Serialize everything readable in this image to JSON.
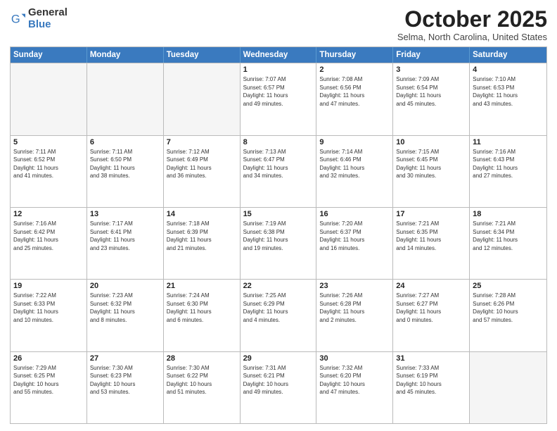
{
  "header": {
    "logo_general": "General",
    "logo_blue": "Blue",
    "month_title": "October 2025",
    "location": "Selma, North Carolina, United States"
  },
  "weekdays": [
    "Sunday",
    "Monday",
    "Tuesday",
    "Wednesday",
    "Thursday",
    "Friday",
    "Saturday"
  ],
  "rows": [
    [
      {
        "day": "",
        "info": ""
      },
      {
        "day": "",
        "info": ""
      },
      {
        "day": "",
        "info": ""
      },
      {
        "day": "1",
        "info": "Sunrise: 7:07 AM\nSunset: 6:57 PM\nDaylight: 11 hours\nand 49 minutes."
      },
      {
        "day": "2",
        "info": "Sunrise: 7:08 AM\nSunset: 6:56 PM\nDaylight: 11 hours\nand 47 minutes."
      },
      {
        "day": "3",
        "info": "Sunrise: 7:09 AM\nSunset: 6:54 PM\nDaylight: 11 hours\nand 45 minutes."
      },
      {
        "day": "4",
        "info": "Sunrise: 7:10 AM\nSunset: 6:53 PM\nDaylight: 11 hours\nand 43 minutes."
      }
    ],
    [
      {
        "day": "5",
        "info": "Sunrise: 7:11 AM\nSunset: 6:52 PM\nDaylight: 11 hours\nand 41 minutes."
      },
      {
        "day": "6",
        "info": "Sunrise: 7:11 AM\nSunset: 6:50 PM\nDaylight: 11 hours\nand 38 minutes."
      },
      {
        "day": "7",
        "info": "Sunrise: 7:12 AM\nSunset: 6:49 PM\nDaylight: 11 hours\nand 36 minutes."
      },
      {
        "day": "8",
        "info": "Sunrise: 7:13 AM\nSunset: 6:47 PM\nDaylight: 11 hours\nand 34 minutes."
      },
      {
        "day": "9",
        "info": "Sunrise: 7:14 AM\nSunset: 6:46 PM\nDaylight: 11 hours\nand 32 minutes."
      },
      {
        "day": "10",
        "info": "Sunrise: 7:15 AM\nSunset: 6:45 PM\nDaylight: 11 hours\nand 30 minutes."
      },
      {
        "day": "11",
        "info": "Sunrise: 7:16 AM\nSunset: 6:43 PM\nDaylight: 11 hours\nand 27 minutes."
      }
    ],
    [
      {
        "day": "12",
        "info": "Sunrise: 7:16 AM\nSunset: 6:42 PM\nDaylight: 11 hours\nand 25 minutes."
      },
      {
        "day": "13",
        "info": "Sunrise: 7:17 AM\nSunset: 6:41 PM\nDaylight: 11 hours\nand 23 minutes."
      },
      {
        "day": "14",
        "info": "Sunrise: 7:18 AM\nSunset: 6:39 PM\nDaylight: 11 hours\nand 21 minutes."
      },
      {
        "day": "15",
        "info": "Sunrise: 7:19 AM\nSunset: 6:38 PM\nDaylight: 11 hours\nand 19 minutes."
      },
      {
        "day": "16",
        "info": "Sunrise: 7:20 AM\nSunset: 6:37 PM\nDaylight: 11 hours\nand 16 minutes."
      },
      {
        "day": "17",
        "info": "Sunrise: 7:21 AM\nSunset: 6:35 PM\nDaylight: 11 hours\nand 14 minutes."
      },
      {
        "day": "18",
        "info": "Sunrise: 7:21 AM\nSunset: 6:34 PM\nDaylight: 11 hours\nand 12 minutes."
      }
    ],
    [
      {
        "day": "19",
        "info": "Sunrise: 7:22 AM\nSunset: 6:33 PM\nDaylight: 11 hours\nand 10 minutes."
      },
      {
        "day": "20",
        "info": "Sunrise: 7:23 AM\nSunset: 6:32 PM\nDaylight: 11 hours\nand 8 minutes."
      },
      {
        "day": "21",
        "info": "Sunrise: 7:24 AM\nSunset: 6:30 PM\nDaylight: 11 hours\nand 6 minutes."
      },
      {
        "day": "22",
        "info": "Sunrise: 7:25 AM\nSunset: 6:29 PM\nDaylight: 11 hours\nand 4 minutes."
      },
      {
        "day": "23",
        "info": "Sunrise: 7:26 AM\nSunset: 6:28 PM\nDaylight: 11 hours\nand 2 minutes."
      },
      {
        "day": "24",
        "info": "Sunrise: 7:27 AM\nSunset: 6:27 PM\nDaylight: 11 hours\nand 0 minutes."
      },
      {
        "day": "25",
        "info": "Sunrise: 7:28 AM\nSunset: 6:26 PM\nDaylight: 10 hours\nand 57 minutes."
      }
    ],
    [
      {
        "day": "26",
        "info": "Sunrise: 7:29 AM\nSunset: 6:25 PM\nDaylight: 10 hours\nand 55 minutes."
      },
      {
        "day": "27",
        "info": "Sunrise: 7:30 AM\nSunset: 6:23 PM\nDaylight: 10 hours\nand 53 minutes."
      },
      {
        "day": "28",
        "info": "Sunrise: 7:30 AM\nSunset: 6:22 PM\nDaylight: 10 hours\nand 51 minutes."
      },
      {
        "day": "29",
        "info": "Sunrise: 7:31 AM\nSunset: 6:21 PM\nDaylight: 10 hours\nand 49 minutes."
      },
      {
        "day": "30",
        "info": "Sunrise: 7:32 AM\nSunset: 6:20 PM\nDaylight: 10 hours\nand 47 minutes."
      },
      {
        "day": "31",
        "info": "Sunrise: 7:33 AM\nSunset: 6:19 PM\nDaylight: 10 hours\nand 45 minutes."
      },
      {
        "day": "",
        "info": ""
      }
    ]
  ]
}
